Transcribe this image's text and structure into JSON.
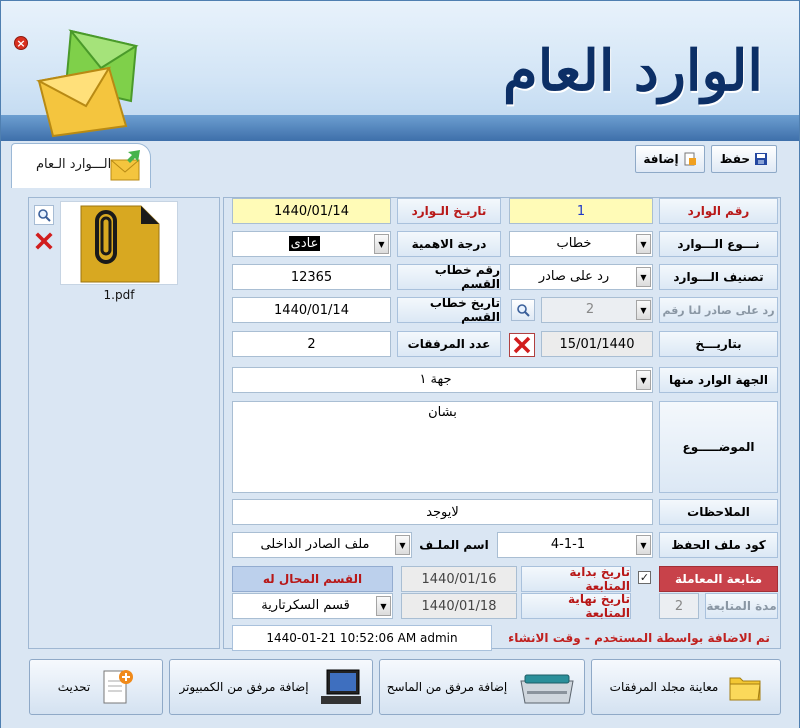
{
  "app": {
    "title": "الوارد العام"
  },
  "tab": {
    "label": "الـــوارد الـعام"
  },
  "toolbar": {
    "save_label": "حفظ",
    "add_label": "إضافة"
  },
  "attachment": {
    "file_name": "1.pdf"
  },
  "form": {
    "incoming_number_label": "رقم الوارد",
    "incoming_number": "1",
    "incoming_date_label": "تاريـخ الـوارد",
    "incoming_date": "1440/01/14",
    "type_label": "نـــوع الـــوارد",
    "type_value": "خطاب",
    "importance_label": "درجة الاهمية",
    "importance_value": "عادى",
    "classification_label": "تصنيف الـــوارد",
    "classification_value": "رد على صادر",
    "dept_letter_no_label": "رقم خطاب القسم",
    "dept_letter_no": "12365",
    "reply_to_label": "رد على صادر لنا رقم",
    "reply_to_value": "2",
    "dept_letter_date_label": "تاريخ خطاب القسم",
    "dept_letter_date": "1440/01/14",
    "dated_label": "بتاريـــخ",
    "dated_value": "15/01/1440",
    "attachments_count_label": "عدد المرفقات",
    "attachments_count": "2",
    "source_label": "الجهة الوارد منها",
    "source_value": "جهة ١",
    "subject_label": "الموضـــــوع",
    "subject_value": "بشان",
    "notes_label": "الملاحظات",
    "notes_value": "لايوجد",
    "file_code_label": "كود ملف الحفظ",
    "file_code_value": "4-1-1",
    "file_name_label": "اسم الملـف",
    "file_name_value": "ملف الصادر الداخلى",
    "follow_label": "متابعة المعاملة",
    "follow_start_label": "تاريخ بداية المتابعة",
    "follow_start_value": "1440/01/16",
    "follow_end_label": "تاريخ نهاية المتابعة",
    "follow_end_value": "1440/01/18",
    "assigned_dept_label": "القسم المحال له",
    "assigned_dept_value": "قسم السكرتارية",
    "follow_duration_label": "مدة المتابعة",
    "follow_duration_value": "2",
    "audit_label": "تم الاضافة بواسطة المستخدم - وقت الانشاء",
    "audit_value": "1440-01-21   10:52:06 AM   admin"
  },
  "actions": {
    "preview_folder": "معاينة مجلد المرفقات",
    "scan_add": "إضافة مرفق من الماسح",
    "pc_add": "إضافة مرفق من الكمبيوتر",
    "refresh": "تحديث"
  }
}
